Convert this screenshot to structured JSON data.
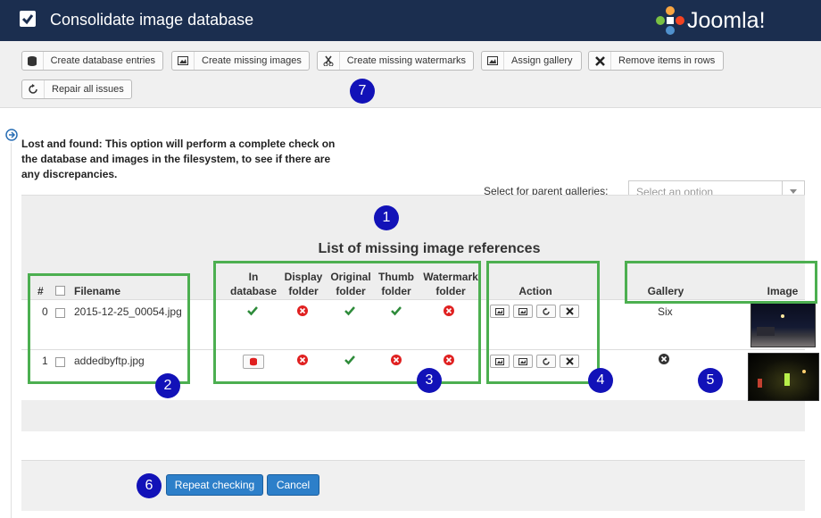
{
  "header": {
    "title": "Consolidate image database",
    "logo_text": "Joomla!"
  },
  "toolbar": {
    "buttons": [
      {
        "label": "Create database entries",
        "icon": "database-icon"
      },
      {
        "label": "Create missing images",
        "icon": "image-icon"
      },
      {
        "label": "Create missing watermarks",
        "icon": "scissors-icon"
      },
      {
        "label": "Assign gallery",
        "icon": "image-icon"
      },
      {
        "label": "Remove items in rows",
        "icon": "close-icon"
      },
      {
        "label": "Repair all issues",
        "icon": "refresh-icon"
      }
    ]
  },
  "description": "Lost and found: This option will perform a complete check on the database and images in the filesystem, to see if there are any discrepancies.",
  "parent_galleries": {
    "label": "Select for parent galleries:",
    "placeholder": "Select an option"
  },
  "table": {
    "title": "List of missing image references",
    "headers": {
      "num": "#",
      "filename": "Filename",
      "in_database": [
        "In",
        "database"
      ],
      "display_folder": [
        "Display",
        "folder"
      ],
      "original_folder": [
        "Original",
        "folder"
      ],
      "thumb_folder": [
        "Thumb",
        "folder"
      ],
      "watermark_folder": [
        "Watermark",
        "folder"
      ],
      "action": "Action",
      "gallery": "Gallery",
      "image": "Image"
    },
    "rows": [
      {
        "num": "0",
        "filename": "2015-12-25_00054.jpg",
        "in_database": "ok",
        "display_folder": "missing",
        "original_folder": "ok",
        "thumb_folder": "ok",
        "watermark_folder": "missing",
        "gallery": "Six"
      },
      {
        "num": "1",
        "filename": "addedbyftp.jpg",
        "in_database": "create-button",
        "display_folder": "missing",
        "original_folder": "ok",
        "thumb_folder": "missing",
        "watermark_folder": "missing",
        "gallery": "none"
      }
    ]
  },
  "footer": {
    "repeat_label": "Repeat checking",
    "cancel_label": "Cancel"
  },
  "annotations": [
    "1",
    "2",
    "3",
    "4",
    "5",
    "6",
    "7"
  ],
  "colors": {
    "header_bg": "#1b2e4f",
    "highlight_green": "#4caf50",
    "badge_blue": "#1212b8",
    "check_green": "#2e8b3a",
    "cross_red": "#e02020",
    "primary_button": "#2d7fc9"
  }
}
